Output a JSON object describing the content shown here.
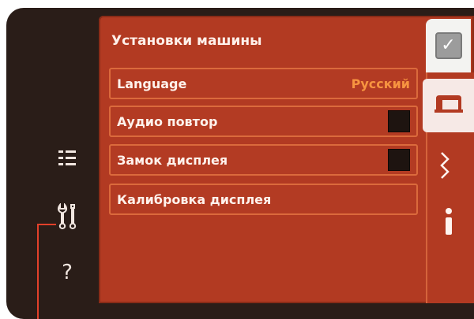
{
  "panel": {
    "title": "Установки машины"
  },
  "settings": [
    {
      "label": "Language",
      "value": "Русский"
    },
    {
      "label": "Аудио повтор",
      "checked": false
    },
    {
      "label": "Замок дисплея",
      "checked": false
    },
    {
      "label": "Калибровка дисплея"
    }
  ],
  "left_icons": [
    "list-icon",
    "tools-icon",
    "help-icon"
  ],
  "left_text": {
    "help": "?"
  },
  "tabs": [
    "ok-check-icon",
    "sewing-machine-icon",
    "stitch-icon",
    "info-icon"
  ],
  "colors": {
    "panel_bg": "#b23a22",
    "row_border": "#db6a3c",
    "value_text": "#f79440",
    "bezel": "#2a1d18",
    "pointer": "#e2412a"
  }
}
